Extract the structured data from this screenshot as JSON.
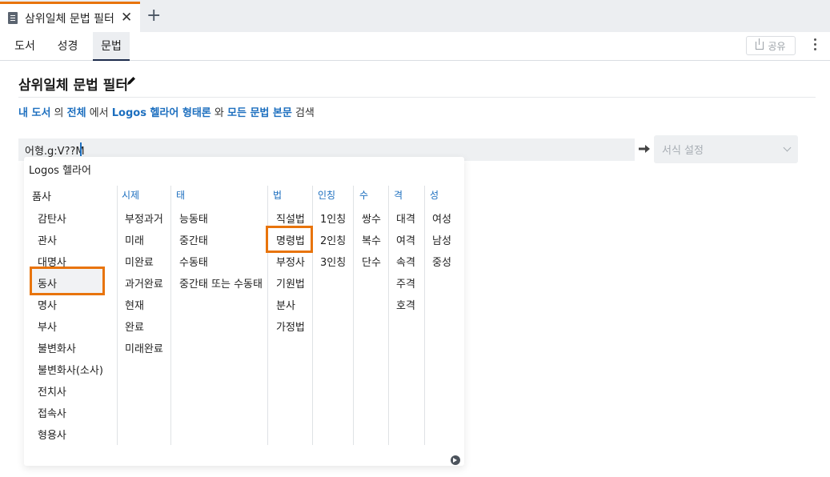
{
  "tab": {
    "title": "삼위일체 문법 필터",
    "close": "✕",
    "new_tab": "+"
  },
  "nav": {
    "tabs": [
      "도서",
      "성경",
      "문법"
    ],
    "active": "문법",
    "share_label": "공유"
  },
  "page": {
    "title": "삼위일체 문법 필터"
  },
  "scope": {
    "link1": "내 도서",
    "text1": " 의 ",
    "link2": "전체",
    "text2": " 에서 ",
    "link3": "Logos 헬라어 형태론",
    "text3": " 와 ",
    "link4": "모든 문법 본문",
    "text4": " 검색"
  },
  "query": {
    "value": "어형.g:V??M",
    "format_placeholder": "서식 설정"
  },
  "panel": {
    "header": "Logos 헬라어",
    "pos_header": "품사",
    "pos": [
      "감탄사",
      "관사",
      "대명사",
      "동사",
      "명사",
      "부사",
      "불변화사",
      "불변화사(소사)",
      "전치사",
      "접속사",
      "형용사"
    ],
    "tense_header": "시제",
    "tense": [
      "부정과거",
      "미래",
      "미완료",
      "과거완료",
      "현재",
      "완료",
      "미래완료"
    ],
    "voice_header": "태",
    "voice": [
      "능동태",
      "중간태",
      "수동태",
      "중간태 또는 수동태"
    ],
    "mood_header": "법",
    "mood": [
      "직설법",
      "명령법",
      "부정사",
      "기원법",
      "분사",
      "가정법"
    ],
    "person_header": "인칭",
    "person": [
      "1인칭",
      "2인칭",
      "3인칭"
    ],
    "number_header": "수",
    "number": [
      "쌍수",
      "복수",
      "단수"
    ],
    "case_header": "격",
    "case": [
      "대격",
      "여격",
      "속격",
      "주격",
      "호격"
    ],
    "gender_header": "성",
    "gender": [
      "여성",
      "남성",
      "중성"
    ],
    "highlighted": [
      "동사",
      "명령법"
    ]
  },
  "colors": {
    "accent_orange": "#e8740c",
    "link_blue": "#1d6fbf"
  },
  "icons": [
    "document-icon",
    "close-icon",
    "plus-icon",
    "share-icon",
    "more-vertical-icon",
    "pencil-icon",
    "arrow-right-icon",
    "chevron-down-icon",
    "circle-arrow-icon"
  ]
}
